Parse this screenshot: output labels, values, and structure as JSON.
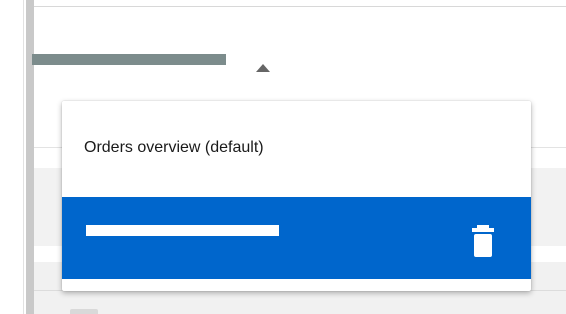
{
  "menu": {
    "items": [
      {
        "label": "Orders overview (default)",
        "selected": false
      },
      {
        "label": "",
        "selected": true,
        "action_icon": "trash-icon"
      }
    ]
  },
  "colors": {
    "selected_bg": "#0066cc",
    "selected_fg": "#ffffff",
    "redaction_bar": "#7c8c8c",
    "caret": "#666666"
  },
  "icons": {
    "dropdown_caret": "caret-up-icon",
    "delete": "trash-icon"
  }
}
